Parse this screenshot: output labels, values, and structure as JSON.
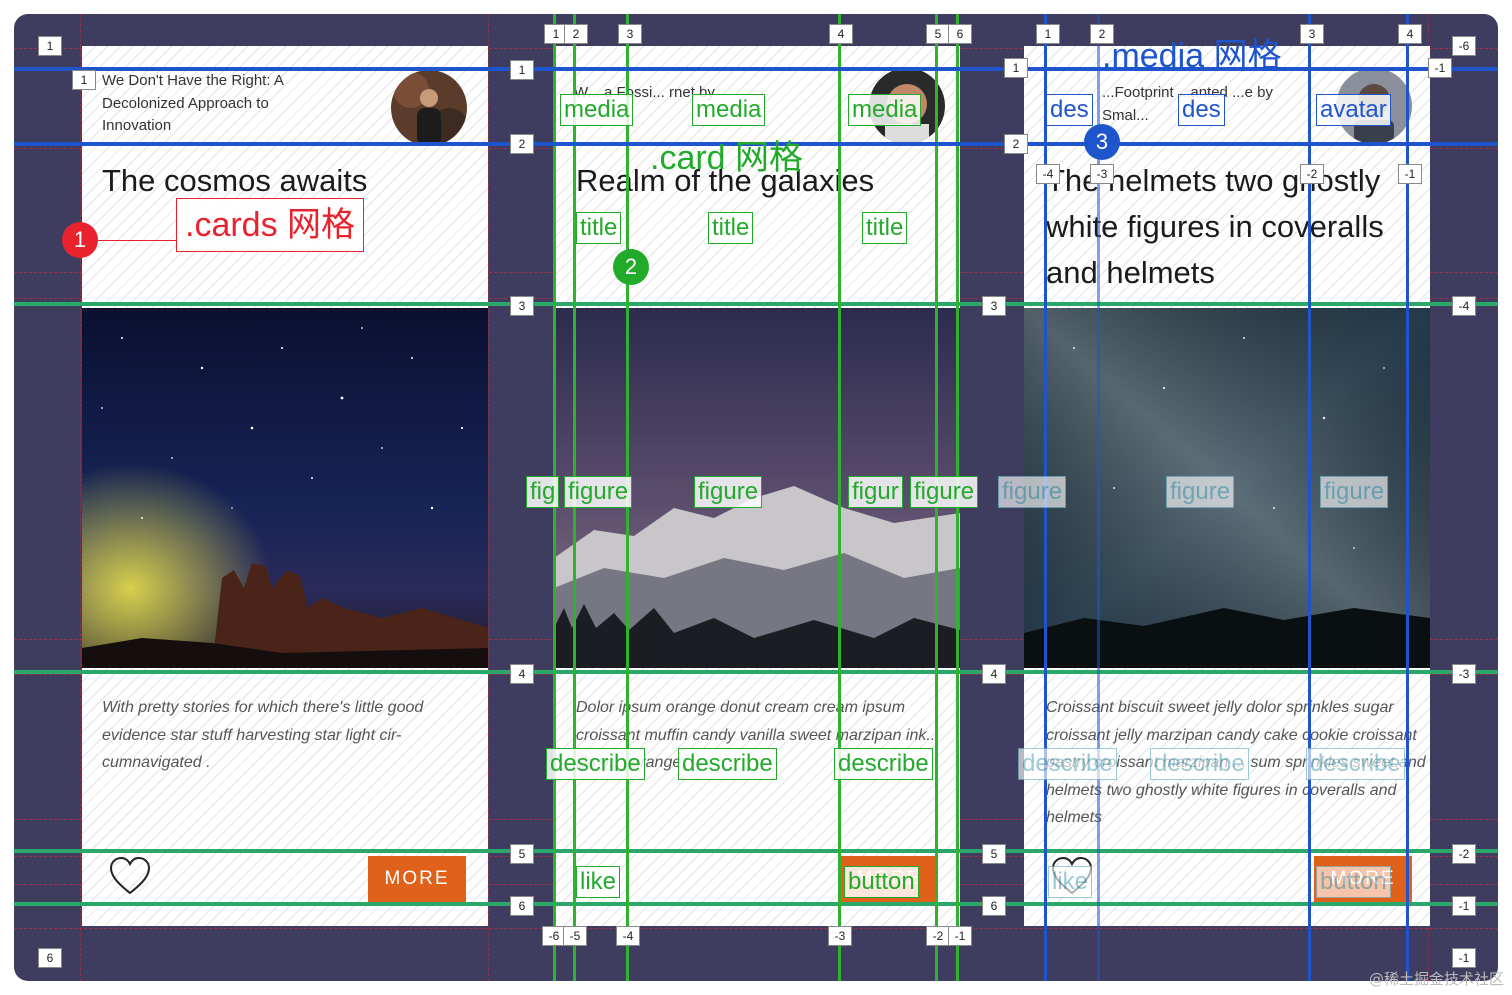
{
  "cards": [
    {
      "media_text": "We Don't Have the Right: A Decolonized Approach to Innovation",
      "title": "The cosmos awaits",
      "description": "With pretty stories for which there's little good evidence star stuff harvesting star light cir- cumnavigated .",
      "button_label": "MORE"
    },
    {
      "media_text": "W... a Fossi... rnet by",
      "title": "Realm of the galaxies",
      "description": "Dolor ipsum orange donut cream cream ipsum croissant muffin candy vanilla sweet marzipan ink... illa or... orange.",
      "button_label": "MORE"
    },
    {
      "media_text": "...Footprint ...anted ...e by Smal...",
      "title": "The helmets two ghostly white figures in coveralls and helmets",
      "description": "Croissant biscuit sweet jelly dolor sprinkles sugar croissant jelly marzipan candy cake cookie croissant pastry croissant marzipan ... sum sprinkles sweet.and helmets two ghostly white figures in coveralls and helmets",
      "button_label": "MORE"
    }
  ],
  "overlay_labels": {
    "cards_grid": ".cards 网格",
    "card_grid": ".card 网格",
    "media_grid": ".media 网格",
    "media": "media",
    "title": "title",
    "figure": "figure",
    "fig": "fig",
    "figur": "figur",
    "describe": "describe",
    "like": "like",
    "button": "button",
    "des": "des",
    "avatar": "avatar"
  },
  "circle_markers": [
    "1",
    "2",
    "3"
  ],
  "colors": {
    "background": "#3f3d5f",
    "more_button": "#e0611a",
    "cards_grid": "#e8232d",
    "card_grid": "#22aa2a",
    "media_grid": "#1f55cc"
  },
  "watermark": "@稀土掘金技术社区"
}
